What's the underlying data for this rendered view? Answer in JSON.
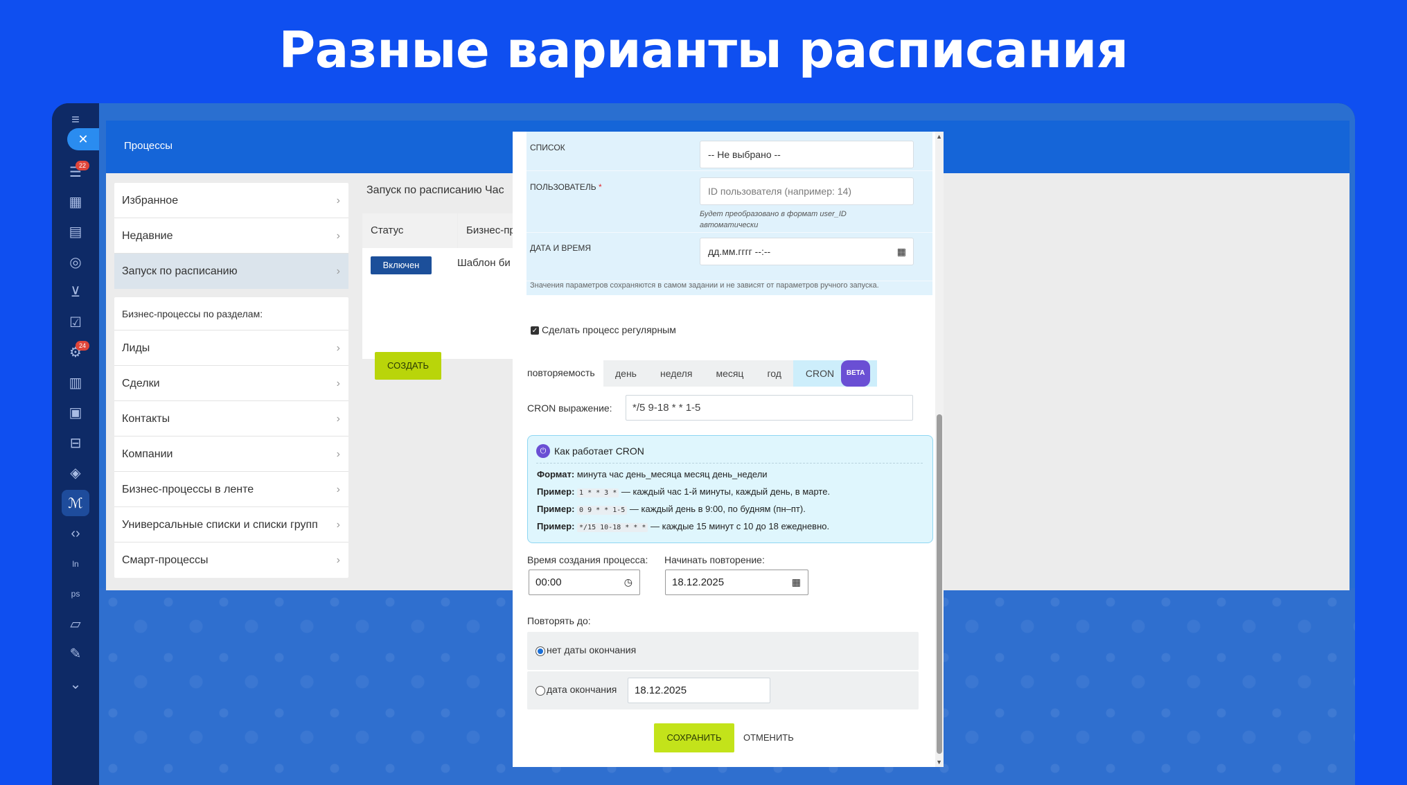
{
  "headline": "Разные варианты расписания",
  "app": {
    "title": "Процессы"
  },
  "leftbar": {
    "badges": [
      "22",
      "24"
    ],
    "close_icon": "close-icon",
    "icons": [
      "hamburger-icon",
      "feed-icon",
      "calendar-icon",
      "storage-icon",
      "target-icon",
      "cart-icon",
      "tasks-icon",
      "sites-icon",
      "chart-icon",
      "tv-icon",
      "inbox-icon",
      "box-icon",
      "brand-icon",
      "code-icon",
      "ln-icon",
      "ps-icon",
      "doc-icon",
      "pen-icon",
      "chevron-down-icon"
    ]
  },
  "sidebar": {
    "group1": [
      {
        "label": "Избранное"
      },
      {
        "label": "Недавние"
      },
      {
        "label": "Запуск по расписанию",
        "active": true
      }
    ],
    "group2_header": "Бизнес-процессы по разделам:",
    "group2": [
      {
        "label": "Лиды"
      },
      {
        "label": "Сделки"
      },
      {
        "label": "Контакты"
      },
      {
        "label": "Компании"
      },
      {
        "label": "Бизнес-процессы в ленте"
      },
      {
        "label": "Универсальные списки и списки групп"
      },
      {
        "label": "Смарт-процессы"
      }
    ]
  },
  "main": {
    "tabs_text": "Запуск по расписанию    Час",
    "table": {
      "headers": [
        "Статус",
        "Бизнес-про"
      ],
      "row": {
        "status": "Включен",
        "template": "Шаблон би"
      }
    },
    "create_label": "СОЗДАТЬ"
  },
  "modal": {
    "params": {
      "list_label": "СПИСОК",
      "list_value": "-- Не выбрано --",
      "user_label": "ПОЛЬЗОВАТЕЛЬ",
      "user_required": "*",
      "user_placeholder": "ID пользователя (например: 14)",
      "user_hint": "Будет преобразовано в формат user_ID автоматически",
      "datetime_label": "ДАТА И ВРЕМЯ",
      "datetime_value": "дд.мм.гггг --:--",
      "note": "Значения параметров сохраняются в самом задании и не зависят от параметров ручного запуска."
    },
    "regular_label": "Сделать процесс регулярным",
    "repeat": {
      "label": "повторяемость",
      "tabs": [
        "день",
        "неделя",
        "месяц",
        "год"
      ],
      "cron_tab": "CRON",
      "beta": "BETA",
      "selected": "CRON"
    },
    "cron": {
      "label": "CRON выражение:",
      "value": "*/5 9-18 * * 1-5"
    },
    "help": {
      "title": "Как работает CRON",
      "format_label": "Формат:",
      "format_text": "минута час день_месяца месяц день_недели",
      "examples": [
        {
          "label": "Пример:",
          "code": "1 * * 3 *",
          "text": "— каждый час 1-й минуты, каждый день, в марте."
        },
        {
          "label": "Пример:",
          "code": "0 9 * * 1-5",
          "text": "— каждый день в 9:00, по будням (пн–пт)."
        },
        {
          "label": "Пример:",
          "code": "*/15 10-18 * * *",
          "text": "— каждые 15 минут с 10 до 18 ежедневно."
        }
      ]
    },
    "create_time": {
      "label": "Время создания процесса:",
      "value": "00:00"
    },
    "start_repeat": {
      "label": "Начинать повторение:",
      "value": "18.12.2025"
    },
    "until": {
      "label": "Повторять до:",
      "no_end": "нет даты окончания",
      "end_date_label": "дата окончания",
      "end_date_value": "18.12.2025",
      "selected": "no_end"
    },
    "save_label": "СОХРАНИТЬ",
    "cancel_label": "ОТМЕНИТЬ"
  }
}
